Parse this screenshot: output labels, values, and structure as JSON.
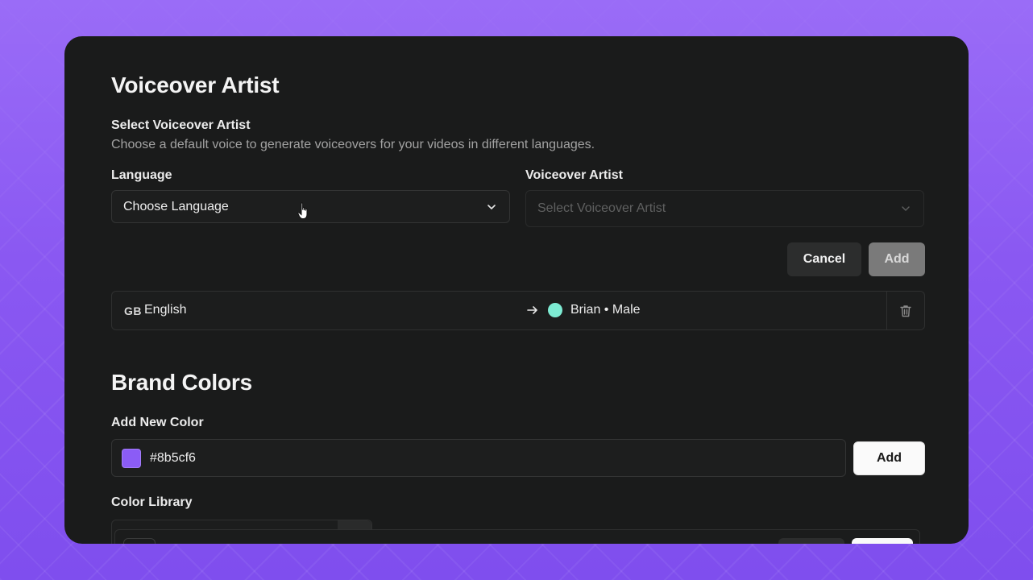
{
  "voiceover": {
    "title": "Voiceover Artist",
    "subtitle": "Select Voiceover Artist",
    "description": "Choose a default voice to generate voiceovers for your videos in different languages.",
    "language_label": "Language",
    "language_value": "Choose Language",
    "artist_label": "Voiceover Artist",
    "artist_placeholder": "Select Voiceover Artist",
    "cancel_label": "Cancel",
    "add_label": "Add",
    "entries": [
      {
        "flag": "GB",
        "language": "English",
        "voice": "Brian • Male",
        "voice_color": "#7eebd3"
      }
    ]
  },
  "brand": {
    "title": "Brand Colors",
    "add_new_label": "Add New Color",
    "color_value": "#8b5cf6",
    "swatch_color": "#8b5cf6",
    "add_label": "Add",
    "library_label": "Color Library"
  },
  "colors": {
    "background": "#8b5cf6",
    "panel": "#1a1b1b"
  }
}
